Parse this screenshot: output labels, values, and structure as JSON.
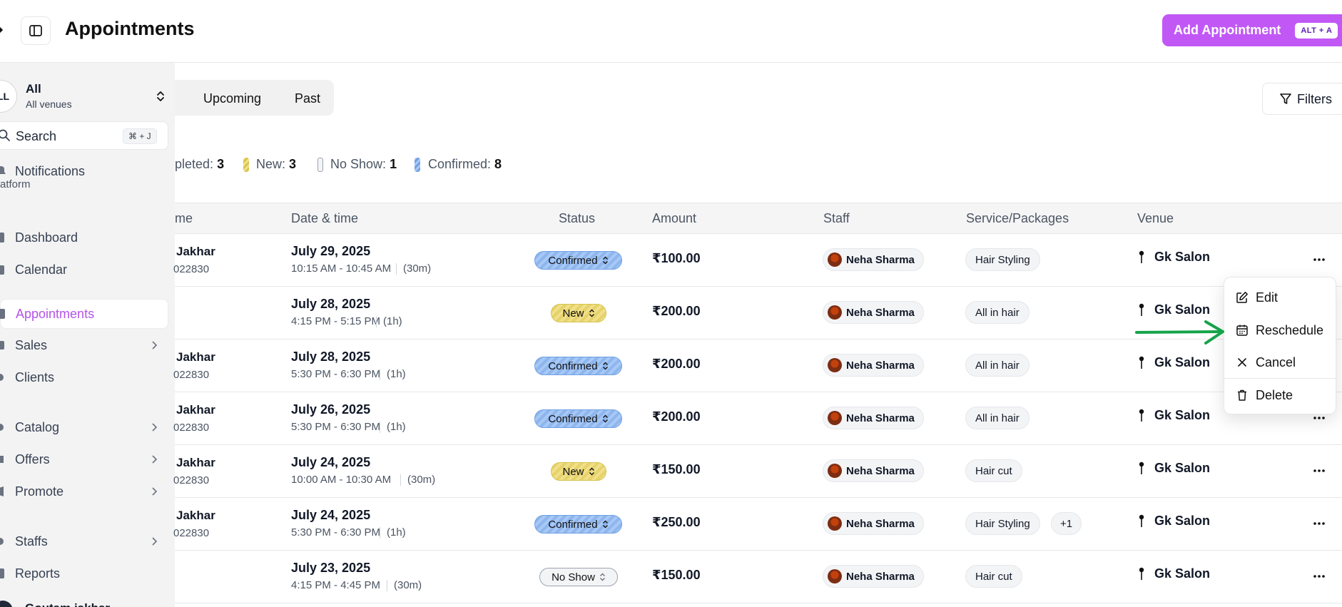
{
  "header": {
    "title": "Appointments",
    "add_button": "Add Appointment",
    "add_shortcut": "ALT + A"
  },
  "sidebar": {
    "venue_avatar": "LL",
    "venue_title": "All",
    "venue_subtitle": "All venues",
    "search_label": "Search",
    "search_shortcut": "⌘ + J",
    "notifications": "Notifications",
    "section_platform": "atform",
    "items": [
      {
        "label": "Dashboard"
      },
      {
        "label": "Calendar"
      },
      {
        "label": "Appointments"
      },
      {
        "label": "Sales"
      },
      {
        "label": "Clients"
      },
      {
        "label": "Catalog"
      },
      {
        "label": "Offers"
      },
      {
        "label": "Promote"
      },
      {
        "label": "Staffs"
      },
      {
        "label": "Reports"
      }
    ],
    "footer_user": "Goutam jakhar"
  },
  "tabs": [
    "Upcoming",
    "Past"
  ],
  "filters_label": "Filters",
  "legend": [
    {
      "label": "pleted:",
      "count": "3",
      "color": "#a3e635"
    },
    {
      "label": "New:",
      "count": "3",
      "color": "#e6d26a"
    },
    {
      "label": "No Show:",
      "count": "1",
      "color": "#e5e7eb"
    },
    {
      "label": "Confirmed:",
      "count": "8",
      "color": "#8db6ee"
    }
  ],
  "table": {
    "headers": [
      "me",
      "Date & time",
      "Status",
      "Amount",
      "Staff",
      "Service/Packages",
      "Venue"
    ],
    "rows": [
      {
        "name": "Jakhar",
        "phone": "022830",
        "date": "July 29, 2025",
        "time": "10:15 AM - 10:45 AM",
        "duration": "(30m)",
        "status": "Confirmed",
        "amount": "₹100.00",
        "staff": "Neha Sharma",
        "service": "Hair Styling",
        "extra": "",
        "venue": "Gk Salon"
      },
      {
        "name": "",
        "phone": "",
        "date": "July 28, 2025",
        "time": "4:15 PM - 5:15 PM",
        "duration": "(1h)",
        "status": "New",
        "amount": "₹200.00",
        "staff": "Neha Sharma",
        "service": "All in hair",
        "extra": "",
        "venue": "Gk Salon"
      },
      {
        "name": "Jakhar",
        "phone": "022830",
        "date": "July 28, 2025",
        "time": "5:30 PM - 6:30 PM",
        "duration": "(1h)",
        "status": "Confirmed",
        "amount": "₹200.00",
        "staff": "Neha Sharma",
        "service": "All in hair",
        "extra": "",
        "venue": "Gk Salon"
      },
      {
        "name": "Jakhar",
        "phone": "022830",
        "date": "July 26, 2025",
        "time": "5:30 PM - 6:30 PM",
        "duration": "(1h)",
        "status": "Confirmed",
        "amount": "₹200.00",
        "staff": "Neha Sharma",
        "service": "All in hair",
        "extra": "",
        "venue": "Gk Salon"
      },
      {
        "name": "Jakhar",
        "phone": "022830",
        "date": "July 24, 2025",
        "time": "10:00 AM - 10:30 AM",
        "duration": "(30m)",
        "status": "New",
        "amount": "₹150.00",
        "staff": "Neha Sharma",
        "service": "Hair cut",
        "extra": "",
        "venue": "Gk Salon"
      },
      {
        "name": "Jakhar",
        "phone": "022830",
        "date": "July 24, 2025",
        "time": "5:30 PM - 6:30 PM",
        "duration": "(1h)",
        "status": "Confirmed",
        "amount": "₹250.00",
        "staff": "Neha Sharma",
        "service": "Hair Styling",
        "extra": "+1",
        "venue": "Gk Salon"
      },
      {
        "name": "",
        "phone": "",
        "date": "July 23, 2025",
        "time": "4:15 PM - 4:45 PM",
        "duration": "(30m)",
        "status": "No Show",
        "amount": "₹150.00",
        "staff": "Neha Sharma",
        "service": "Hair cut",
        "extra": "",
        "venue": "Gk Salon"
      }
    ]
  },
  "menu": {
    "items": [
      {
        "label": "Edit",
        "icon": "edit-icon"
      },
      {
        "label": "Reschedule",
        "icon": "calendar-icon"
      },
      {
        "label": "Cancel",
        "icon": "close-icon"
      },
      {
        "label": "Delete",
        "icon": "trash-icon"
      }
    ]
  },
  "colors": {
    "accent": "#c158f5",
    "active_nav": "#b453e8",
    "arrow": "#16a34a"
  }
}
